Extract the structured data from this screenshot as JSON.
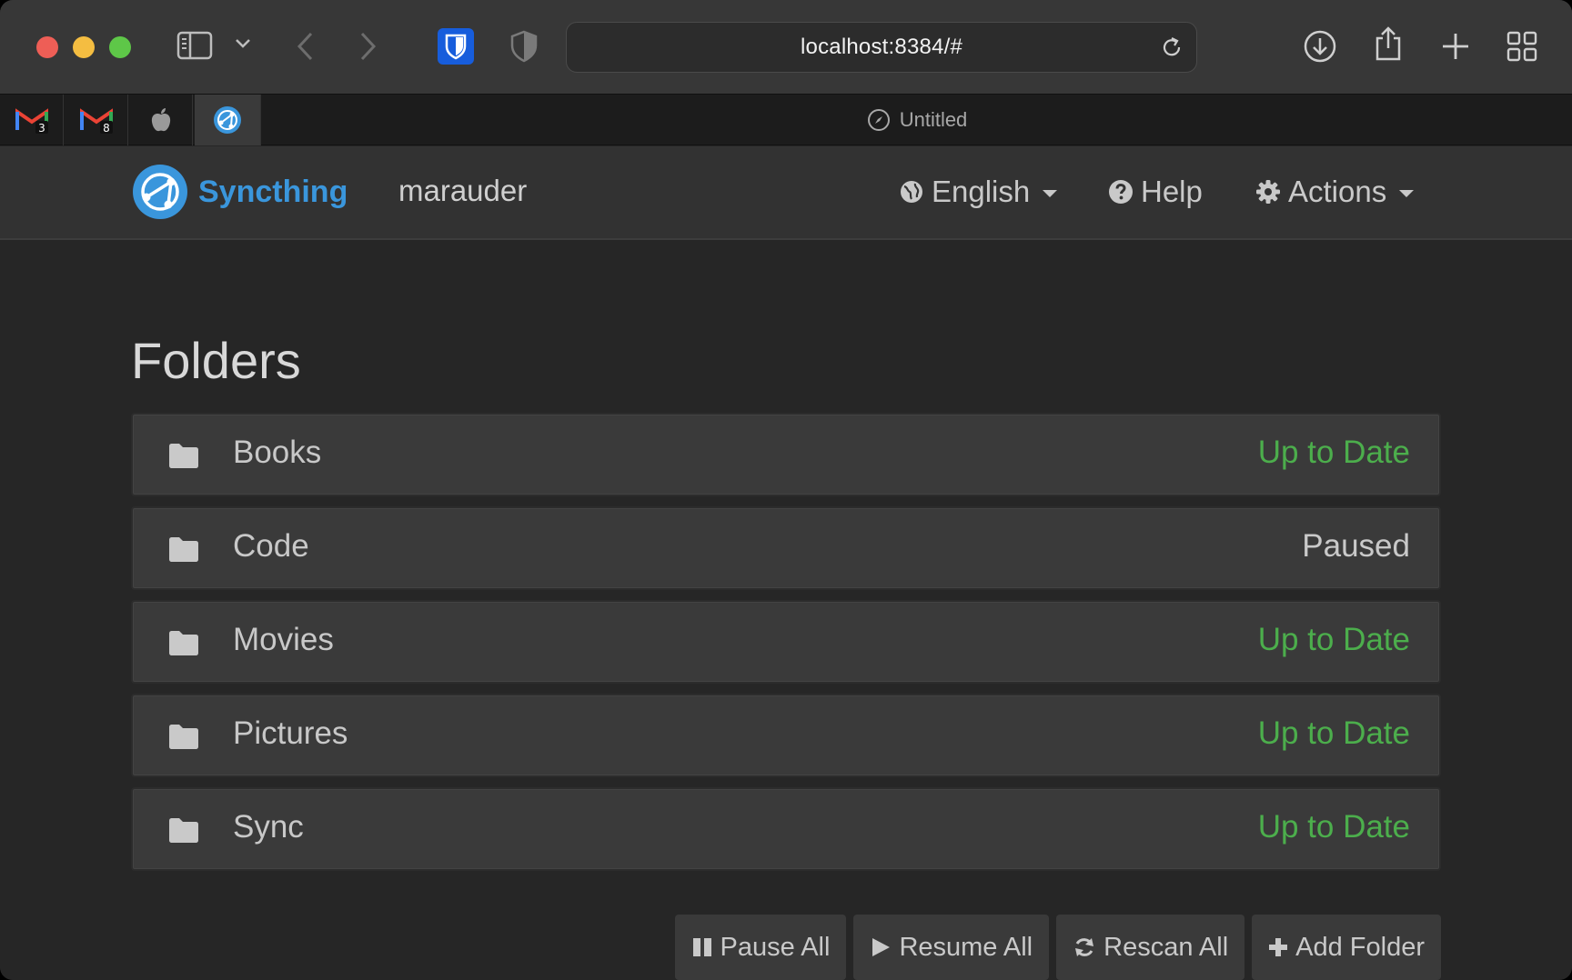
{
  "browser": {
    "url": "localhost:8384/#",
    "tab_title": "Untitled",
    "pinned_tabs": [
      {
        "name": "gmail-tab-1",
        "badge": "3"
      },
      {
        "name": "gmail-tab-2",
        "badge": "8"
      },
      {
        "name": "apple-tab"
      },
      {
        "name": "syncthing-tab",
        "active": true
      }
    ]
  },
  "navbar": {
    "brand": "Syncthing",
    "device": "marauder",
    "language": "English",
    "help": "Help",
    "actions": "Actions"
  },
  "main": {
    "heading": "Folders",
    "folders": [
      {
        "name": "Books",
        "status": "Up to Date",
        "status_color": "#4cae4c"
      },
      {
        "name": "Code",
        "status": "Paused",
        "status_color": "#c9c9c9"
      },
      {
        "name": "Movies",
        "status": "Up to Date",
        "status_color": "#4cae4c"
      },
      {
        "name": "Pictures",
        "status": "Up to Date",
        "status_color": "#4cae4c"
      },
      {
        "name": "Sync",
        "status": "Up to Date",
        "status_color": "#4cae4c"
      }
    ],
    "buttons": {
      "pause_all": "Pause All",
      "resume_all": "Resume All",
      "rescan_all": "Rescan All",
      "add_folder": "Add Folder"
    }
  },
  "colors": {
    "brand": "#3a96dc",
    "up_to_date": "#4cae4c"
  }
}
